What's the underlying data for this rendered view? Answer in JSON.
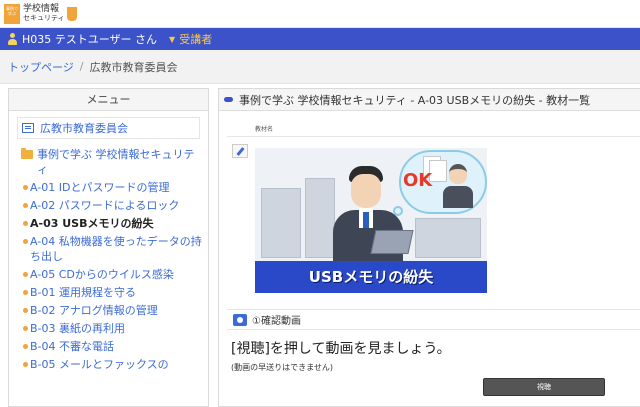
{
  "header": {
    "logo_badge": "事例で学ぶ",
    "logo_line1": "学校情報",
    "logo_line2": "セキュリティ"
  },
  "navbar": {
    "user_name": "H035 テストユーザー さん",
    "role_label": "受講者"
  },
  "breadcrumb": {
    "items": [
      "トップページ",
      "広教市教育委員会"
    ]
  },
  "menu": {
    "title": "メニュー",
    "room": "広教市教育委員会",
    "course": "事例で学ぶ 学校情報セキュリティ",
    "items": [
      {
        "label": "A-01 IDとパスワードの管理",
        "active": false
      },
      {
        "label": "A-02 パスワードによるロック",
        "active": false
      },
      {
        "label": "A-03 USBメモリの紛失",
        "active": true
      },
      {
        "label": "A-04 私物機器を使ったデータの持ち出し",
        "active": false
      },
      {
        "label": "A-05 CDからのウイルス感染",
        "active": false
      },
      {
        "label": "B-01 運用規程を守る",
        "active": false
      },
      {
        "label": "B-02 アナログ情報の管理",
        "active": false
      },
      {
        "label": "B-03 裏紙の再利用",
        "active": false
      },
      {
        "label": "B-04 不審な電話",
        "active": false
      },
      {
        "label": "B-05 メールとファックスの",
        "active": false
      }
    ]
  },
  "content": {
    "title": "事例で学ぶ 学校情報セキュリティ - A-03 USBメモリの紛失 - 教材一覧",
    "column_header": "教材名",
    "thumbnail": {
      "ok_text": "OK",
      "title": "USBメモリの紛失"
    },
    "video_section_title": "①確認動画",
    "instruction": "[視聴]を押して動画を見ましょう。",
    "note": "(動画の早送りはできません)",
    "play_button": "視聴"
  },
  "colors": {
    "nav_blue": "#3c52c8",
    "link_blue": "#3c6bd6",
    "accent_orange": "#f0a43a",
    "role_yellow": "#f7c948"
  }
}
